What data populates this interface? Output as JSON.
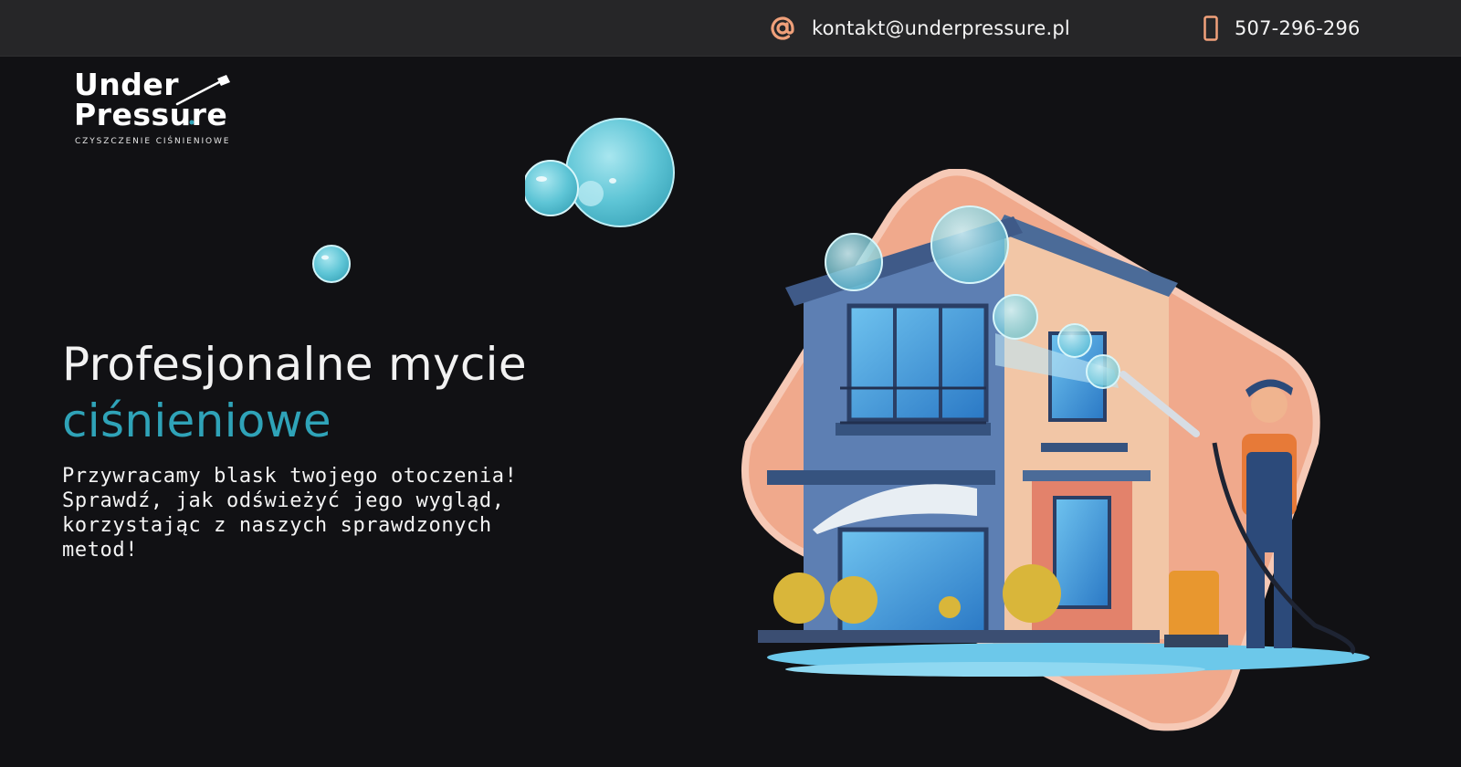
{
  "header": {
    "email": "kontakt@underpressure.pl",
    "phone": "507-296-296"
  },
  "logo": {
    "line1": "Under",
    "line2": "Pressure",
    "tagline": "CZYSZCZENIE CIŚNIENIOWE"
  },
  "hero": {
    "title_line1": "Profesjonalne mycie",
    "title_line2": "ciśnieniowe",
    "subtitle": "Przywracamy blask twojego otoczenia! Sprawdź, jak odświeżyć jego wygląd, korzystając z naszych sprawdzonych metod!"
  },
  "colors": {
    "accent": "#2fa3b8",
    "icon": "#f0a07a",
    "background": "#111114",
    "topbar": "#262628"
  },
  "icons": [
    "at-sign-icon",
    "phone-icon",
    "pressure-washer-icon"
  ]
}
